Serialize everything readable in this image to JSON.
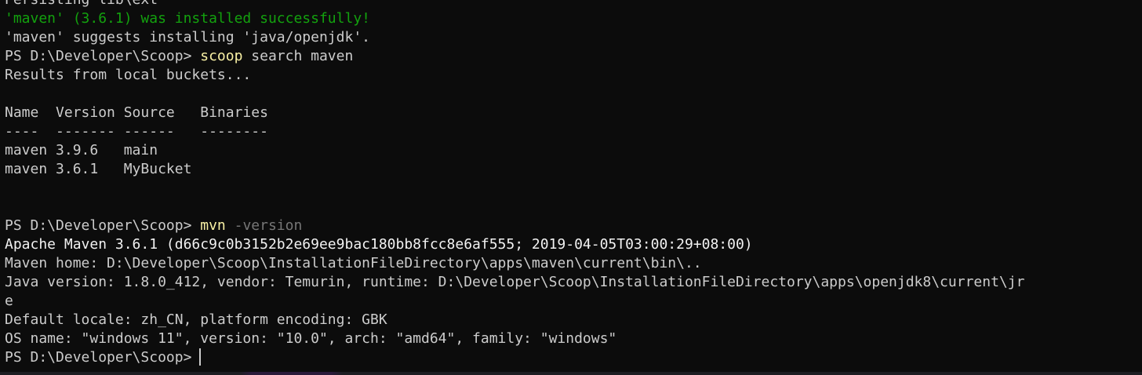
{
  "lines": [
    {
      "segments": [
        {
          "text": "Persisting lib\\ext",
          "style": "normal"
        }
      ]
    },
    {
      "segments": [
        {
          "text": "'maven' (3.6.1) was installed successfully!",
          "style": "green"
        }
      ]
    },
    {
      "segments": [
        {
          "text": "'maven' suggests installing 'java/openjdk'.",
          "style": "normal"
        }
      ]
    },
    {
      "segments": [
        {
          "text": "PS D:\\Developer\\Scoop> ",
          "style": "normal"
        },
        {
          "text": "scoop",
          "style": "yellow"
        },
        {
          "text": " search maven",
          "style": "normal"
        }
      ]
    },
    {
      "segments": [
        {
          "text": "Results from local buckets...",
          "style": "normal"
        }
      ]
    },
    {
      "segments": [
        {
          "text": "",
          "style": "normal"
        }
      ]
    },
    {
      "segments": [
        {
          "text": "Name  Version Source   Binaries",
          "style": "normal"
        }
      ]
    },
    {
      "segments": [
        {
          "text": "----  ------- ------   --------",
          "style": "normal"
        }
      ]
    },
    {
      "segments": [
        {
          "text": "maven 3.9.6   main",
          "style": "normal"
        }
      ]
    },
    {
      "segments": [
        {
          "text": "maven 3.6.1   MyBucket",
          "style": "normal"
        }
      ]
    },
    {
      "segments": [
        {
          "text": "",
          "style": "normal"
        }
      ]
    },
    {
      "segments": [
        {
          "text": "",
          "style": "normal"
        }
      ]
    },
    {
      "segments": [
        {
          "text": "PS D:\\Developer\\Scoop> ",
          "style": "normal"
        },
        {
          "text": "mvn",
          "style": "yellow"
        },
        {
          "text": " -version",
          "style": "dim"
        }
      ]
    },
    {
      "segments": [
        {
          "text": "Apache Maven 3.6.1 (d66c9c0b3152b2e69ee9bac180bb8fcc8e6af555; 2019-04-05T03:00:29+08:00)",
          "style": "bright"
        }
      ]
    },
    {
      "segments": [
        {
          "text": "Maven home: D:\\Developer\\Scoop\\InstallationFileDirectory\\apps\\maven\\current\\bin\\..",
          "style": "normal"
        }
      ]
    },
    {
      "segments": [
        {
          "text": "Java version: 1.8.0_412, vendor: Temurin, runtime: D:\\Developer\\Scoop\\InstallationFileDirectory\\apps\\openjdk8\\current\\jr",
          "style": "normal"
        }
      ]
    },
    {
      "segments": [
        {
          "text": "e",
          "style": "normal"
        }
      ]
    },
    {
      "segments": [
        {
          "text": "Default locale: zh_CN, platform encoding: GBK",
          "style": "normal"
        }
      ]
    },
    {
      "segments": [
        {
          "text": "OS name: \"windows 11\", version: \"10.0\", arch: \"amd64\", family: \"windows\"",
          "style": "normal"
        }
      ]
    },
    {
      "segments": [
        {
          "text": "PS D:\\Developer\\Scoop>",
          "style": "normal"
        }
      ],
      "cursor": true
    }
  ]
}
